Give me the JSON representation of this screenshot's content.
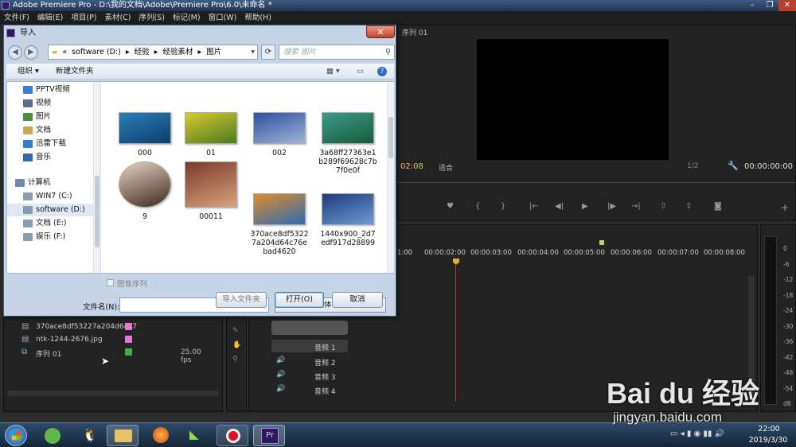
{
  "app": {
    "title": "Adobe Premiere Pro - D:\\我的文档\\Adobe\\Premiere Pro\\6.0\\未命名 *",
    "menu": [
      "文件(F)",
      "编辑(E)",
      "项目(P)",
      "素材(C)",
      "序列(S)",
      "标记(M)",
      "窗口(W)",
      "帮助(H)"
    ],
    "window_controls": [
      "–",
      "❐",
      "✕"
    ]
  },
  "program_monitor": {
    "tab": "序列 01",
    "timecode_left": "02:08",
    "fit": "适合",
    "scale": "1/2",
    "timecode_right": "00:00:00:00"
  },
  "dialog": {
    "title": "导入",
    "close": "✕",
    "path": [
      "«",
      "software (D:)",
      "▸",
      "经验",
      "▸",
      "经验素材",
      "▸",
      "图片"
    ],
    "search_placeholder": "搜索 图片",
    "organize": "组织 ▾",
    "new_folder": "新建文件夹",
    "nav_items": [
      {
        "label": "PPTV视频",
        "color": "#3b7dd8"
      },
      {
        "label": "视频",
        "color": "#5b6f8c"
      },
      {
        "label": "图片",
        "color": "#4d8f3f"
      },
      {
        "label": "文档",
        "color": "#c9a45a"
      },
      {
        "label": "迅雷下载",
        "color": "#2f80d1"
      },
      {
        "label": "音乐",
        "color": "#3567b0"
      },
      {
        "label": "计算机",
        "color": "#6f8bb3"
      },
      {
        "label": "WIN7 (C:)",
        "color": "#8a9cb3"
      },
      {
        "label": "software (D:)",
        "color": "#8a9cb3"
      },
      {
        "label": "文档 (E:)",
        "color": "#8a9cb3"
      },
      {
        "label": "娱乐 (F:)",
        "color": "#8a9cb3"
      }
    ],
    "files": [
      {
        "name": "000",
        "colors": [
          "#2a7db8",
          "#0d3f6b"
        ]
      },
      {
        "name": "01",
        "colors": [
          "#d8c92f",
          "#4b7a21"
        ]
      },
      {
        "name": "002",
        "colors": [
          "#2d4f9e",
          "#9fb6d8"
        ]
      },
      {
        "name": "3a68ff27363e1b289f69628c7b7f0e0f",
        "colors": [
          "#3a9c8a",
          "#1b5b3b"
        ]
      },
      {
        "name": "9",
        "colors": [
          "#e8d3c2",
          "#3b2a20"
        ]
      },
      {
        "name": "00011",
        "colors": [
          "#7a3a2a",
          "#d9a27c"
        ]
      },
      {
        "name": "370ace8df53227a204d64c76ebad4620",
        "colors": [
          "#e08a2a",
          "#2c6db5"
        ]
      },
      {
        "name": "1440x900_2d7edf917d28899",
        "colors": [
          "#1d3c7a",
          "#6e9ad6"
        ]
      }
    ],
    "image_sequence": "图像序列",
    "filename_label": "文件名(N):",
    "filename_value": "",
    "filetype": "所有可支持媒体",
    "import_folder": "导入文件夹",
    "open": "打开(O)",
    "cancel": "取消"
  },
  "project": {
    "items": [
      {
        "name": "370ace8df53227a204d64c7",
        "color": "#e07ad6",
        "rate": ""
      },
      {
        "name": "ntk-1244-2676.jpg",
        "color": "#e07ad6",
        "rate": ""
      },
      {
        "name": "序列 01",
        "color": "#3fae4a",
        "rate": "25.00 fps"
      }
    ]
  },
  "timeline": {
    "ticks": [
      "1:00",
      "00:00:02:00",
      "00:00:03:00",
      "00:00:04:00",
      "00:00:05:00",
      "00:00:06:00",
      "00:00:07:00",
      "00:00:08:00"
    ],
    "audio_tracks": [
      "音频 1",
      "音频 2",
      "音频 3",
      "音频 4"
    ]
  },
  "meter": {
    "labels": [
      "0",
      "-6",
      "-12",
      "-18",
      "-24",
      "-30",
      "-36",
      "-42",
      "-48",
      "-54",
      "dB"
    ]
  },
  "taskbar": {
    "time": "22:00",
    "date": "2019/3/30",
    "pr_label": "Pr"
  },
  "watermark": {
    "logo": "Bai du 经验",
    "url": "jingyan.baidu.com"
  }
}
